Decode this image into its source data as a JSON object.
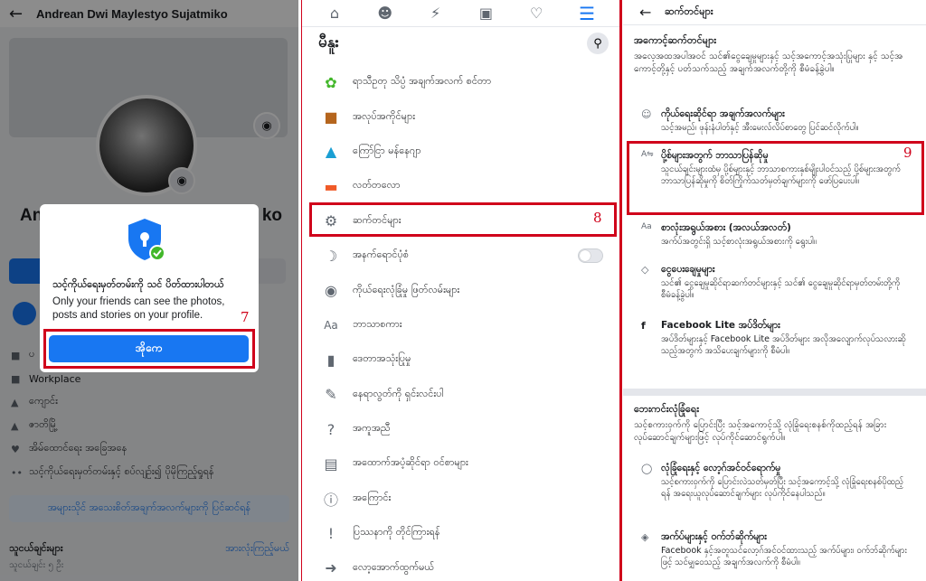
{
  "profile_panel": {
    "header_title": "Andrean Dwi Maylestyo Sujatmiko",
    "name_left": "An",
    "name_right": "ko",
    "list": [
      "ပ",
      "Workplace",
      "ကျောင်း",
      "ဇာတိမြို့",
      "အိမ်ထောင်ရေး အခြေအနေ",
      "သင့်ကိုယ်ရေးမှတ်တမ်းနှင့် စပ်လျဉ်း၍ ပိုမိုကြည့်ရှုရန်"
    ],
    "link_button": "အများသိုင် အသေးစိတ်အချက်အလက်များကို ပြင်ဆင်ရန်",
    "friends_label": "သူငယ်ချင်းများ",
    "friends_count": "သူငယ်ချင်း ၅ ဦး",
    "see_all": "အားလုံးကြည့်မယ်",
    "dialog": {
      "title": "သင့်ကိုယ်ရေးမှတ်တမ်းကို သင် ပိတ်ထားပါတယ်",
      "body": "Only your friends can see the photos, posts and stories on your profile.",
      "ok_label": "အိုကေ",
      "step_number": "7"
    }
  },
  "menu_panel": {
    "title": "မီနူး",
    "items": [
      {
        "label": "ရာသီဥတု သိပ္ပံ အချက်အလက် စင်တာ",
        "icon": "sprout-icon"
      },
      {
        "label": "အလုပ်အကိုင်များ",
        "icon": "briefcase-icon"
      },
      {
        "label": "ကြော်ငြာ မန်နေဂျာ",
        "icon": "ads-manager-icon"
      },
      {
        "label": "လတ်တလော",
        "icon": "recent-icon"
      },
      {
        "label": "ဆက်တင်များ",
        "icon": "gear-icon"
      },
      {
        "label": "အနက်ရောင်ပုံစံ",
        "icon": "moon-icon"
      },
      {
        "label": "ကိုယ်ရေးလုံခြုံမှု ဖြတ်လမ်းများ",
        "icon": "lock-icon"
      },
      {
        "label": "ဘာသာစကား",
        "icon": "language-icon"
      },
      {
        "label": "ဒေတာအသုံးပြုမှု",
        "icon": "bar-chart-icon"
      },
      {
        "label": "နေရာလွတ်ကို ရှင်းလင်းပါ",
        "icon": "broom-icon"
      },
      {
        "label": "အကူအညီ",
        "icon": "help-icon"
      },
      {
        "label": "အထောက်အပံ့ဆိုင်ရာ ဝင်စာများ",
        "icon": "inbox-icon"
      },
      {
        "label": "အကြောင်း",
        "icon": "info-icon"
      },
      {
        "label": "ပြဿနာကို တိုင်ကြားရန်",
        "icon": "warning-icon"
      },
      {
        "label": "လော့အောက်ထွက်မယ်",
        "icon": "logout-icon"
      }
    ],
    "step_number": "8"
  },
  "settings_panel": {
    "title": "ဆက်တင်များ",
    "account_section": {
      "title": "အကောင့်ဆက်တင်များ",
      "desc": "အလေ့အထအပါအဝင် သင်၏ငွေချေမှုများနှင့် သင့်အကောင့်အသုံးပြုများ နှင့် သင့်အကောင့်တို့နှင့် ပတ်သက်သည့် အချက်အလက်တို့ကို စီမံခန့်ခွဲပါ။"
    },
    "items": [
      {
        "title": "ကိုယ်ရေးဆိုင်ရာ အချက်အလက်များ",
        "desc": "သင့်အမည်၊ ဖုန်းနံပါတ်နှင့် အီးမေးလ်လိပ်စာတွေ ပြင်ဆင်လိုက်ပါ။",
        "icon": "person-icon"
      },
      {
        "title": "ပို့စ်များအတွက် ဘာသာပြန်ဆိုမှု",
        "desc": "သူငယ်ချင်းများထံမှ ပို့စ်များနှင့် ဘာသာစကားနှစ်မျိုးပါဝင်သည့် ပို့စ်များအတွက် ဘာသာပြန်ဆိုမှုကို စိတ်ကြိုက်သတ်မှတ်ချက်များကို ဖော်ပြပေးပါ။",
        "icon": "translate-icon"
      },
      {
        "title": "စာလုံးအရွယ်အစား (အလယ်အလတ်)",
        "desc": "အက်ပ်အတွင်းရှိ သင့်စာလုံးအရွယ်အစားကို ရွေးပါ။",
        "icon": "font-size-icon"
      },
      {
        "title": "ငွေပေးချေမှုများ",
        "desc": "သင်၏ ငွေချေမှုဆိုင်ရာဆက်တင်များနှင့် သင်၏ ငွေချေမှုဆိုင်ရာမှတ်တမ်းတို့ကို စီမံခန့်ခွဲပါ။",
        "icon": "payment-icon"
      },
      {
        "title": "Facebook Lite အပ်ဒိတ်များ",
        "desc": "အပ်ဒိတ်များနှင့် Facebook Lite အပ်ဒိတ်များ အလိုအလျောက်လုပ်သလားဆိုသည့်အတွက် အသိပေးချက်များကို စီမံပါ။",
        "icon": "facebook-icon"
      }
    ],
    "security_section": {
      "title": "ဘေးကင်းလုံခြုံရေး",
      "desc": "သင့်စကားဝှက်ကို ပြောင်းပြီး သင့်အကောင့်သို့ လုံခြုံရေးစနစ်ကိုထည့်ရန် အခြားလုပ်ဆောင်ချက်များဖြင့် လုပ်ကိုင်ဆောင်ရွက်ပါ။"
    },
    "security_items": [
      {
        "title": "လုံခြုံရေးနှင့် လော့ဂ်အင်ဝင်ရောက်မှု",
        "desc": "သင့်စကားဝှက်ကို ပြောင်းလဲသတ်မှတ်ပြီး သင့်အကောင့်သို့ လုံခြုံရေးစနစ်ပိုထည့်ရန် အရေးယူလုပ်ဆောင်ချက်များ လုပ်ကိုင်နေပါသည်။",
        "icon": "shield-icon"
      },
      {
        "title": "အက်ပ်များနှင့် ဝက်ဘ်ဆိုက်များ",
        "desc": "Facebook နှင့်အတူသင်လော့ဂ်အင်ဝင်ထားသည့် အက်ပ်များ၊ ဝက်ဘ်ဆိုက်များဖြင့် သင်မျှဝေသည့် အချက်အလက်ကို စီမံပါ။",
        "icon": "cube-icon"
      }
    ],
    "step_number": "9"
  }
}
